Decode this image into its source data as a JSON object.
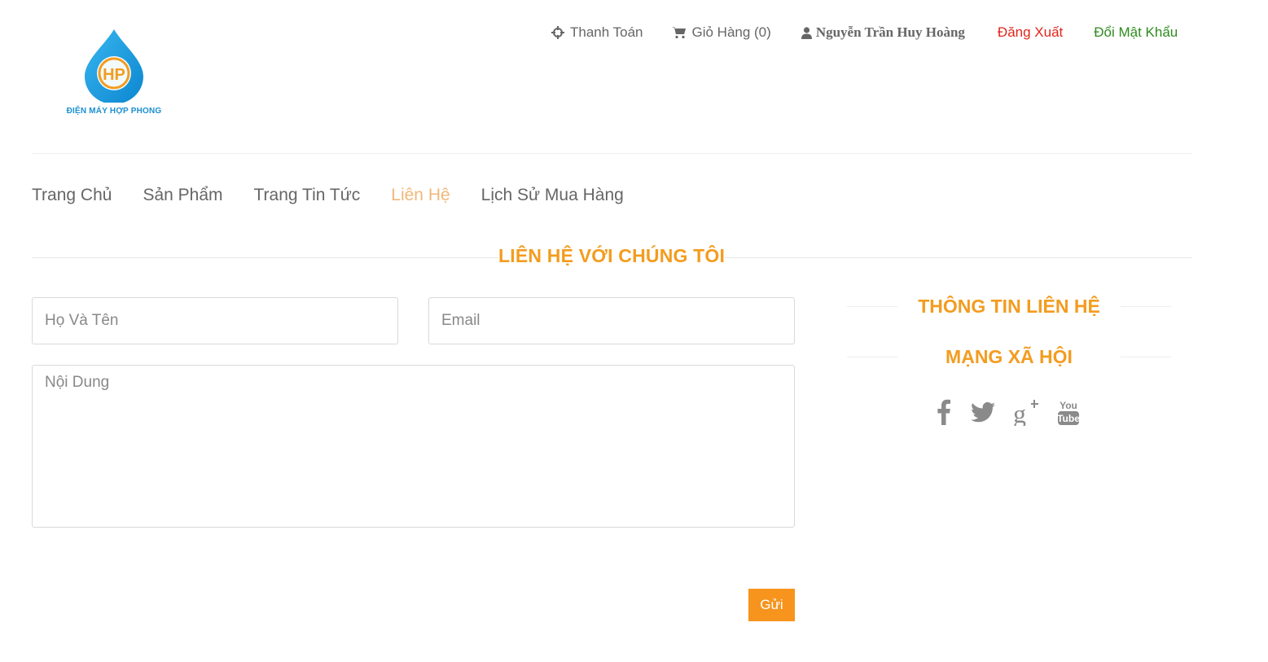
{
  "logo": {
    "caption": "ĐIỆN MÁY HỢP PHONG",
    "monogram": "HP"
  },
  "topbar": {
    "payment": {
      "label": "Thanh Toán",
      "icon": "crosshairs-icon"
    },
    "cart": {
      "label": "Giỏ Hàng (0)",
      "icon": "cart-icon"
    },
    "user": {
      "label": "Nguyễn Trần Huy Hoàng",
      "icon": "user-icon"
    },
    "logout": {
      "label": "Đăng Xuất",
      "color": "#e1251b"
    },
    "change_password": {
      "label": "Đổi Mật Khẩu",
      "color": "#2e8b1e"
    }
  },
  "menu": {
    "items": [
      {
        "label": "Trang Chủ",
        "active": false
      },
      {
        "label": "Sản Phẩm",
        "active": false
      },
      {
        "label": "Trang Tin Tức",
        "active": false
      },
      {
        "label": "Liên Hệ",
        "active": true
      },
      {
        "label": "Lịch Sử Mua Hàng",
        "active": false
      }
    ]
  },
  "contact": {
    "title": "LIÊN HỆ VỚI CHÚNG TÔI",
    "name_placeholder": "Họ Và Tên",
    "email_placeholder": "Email",
    "message_placeholder": "Nội Dung",
    "submit_label": "Gửi"
  },
  "sidebar": {
    "info_title": "THÔNG TIN LIÊN HỆ",
    "social_title": "MẠNG XÃ HỘI",
    "social_icons": [
      "facebook-icon",
      "twitter-icon",
      "google-plus-icon",
      "youtube-icon"
    ]
  },
  "colors": {
    "accent": "#f39c1f",
    "button": "#f7941d",
    "active_menu": "#f0b87a"
  }
}
